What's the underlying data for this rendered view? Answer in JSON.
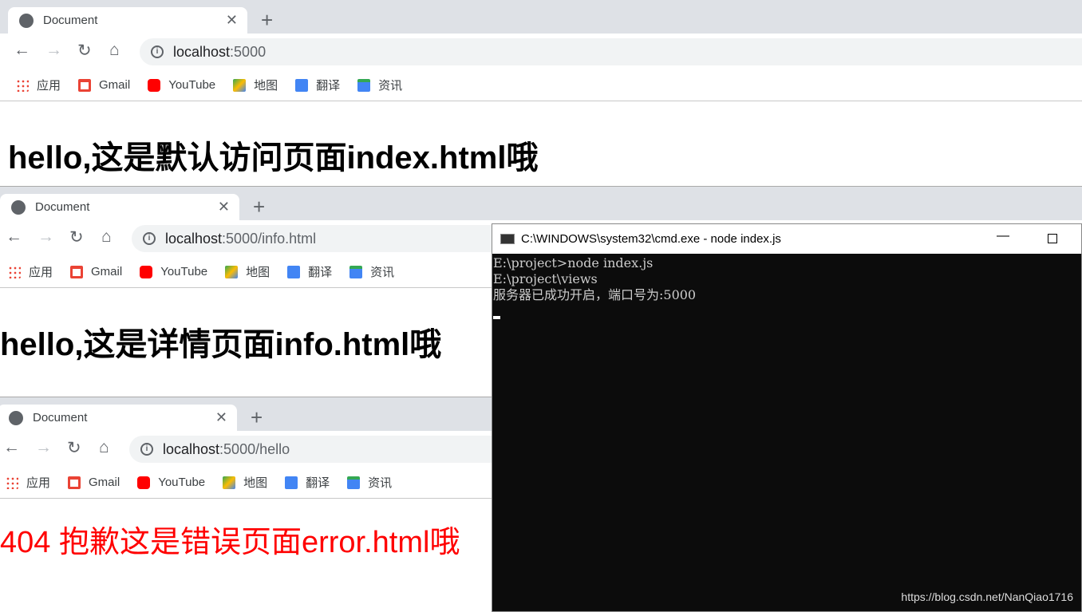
{
  "windows": [
    {
      "tab_title": "Document",
      "url_host": "localhost",
      "url_path": ":5000",
      "heading": "hello,这是默认访问页面index.html哦",
      "type": "h1"
    },
    {
      "tab_title": "Document",
      "url_host": "localhost",
      "url_path": ":5000/info.html",
      "heading": "hello,这是详情页面info.html哦",
      "type": "h1"
    },
    {
      "tab_title": "Document",
      "url_host": "localhost",
      "url_path": ":5000/hello",
      "heading": "404 抱歉这是错误页面error.html哦",
      "type": "error"
    }
  ],
  "bookmarks": [
    {
      "label": "应用",
      "icon": "apps-icon"
    },
    {
      "label": "Gmail",
      "icon": "gmail-icon"
    },
    {
      "label": "YouTube",
      "icon": "youtube-icon"
    },
    {
      "label": "地图",
      "icon": "maps-icon"
    },
    {
      "label": "翻译",
      "icon": "translate-icon"
    },
    {
      "label": "资讯",
      "icon": "news-icon"
    }
  ],
  "cmd": {
    "title": "C:\\WINDOWS\\system32\\cmd.exe - node  index.js",
    "lines": [
      "E:\\project>node index.js",
      "E:\\project\\views",
      "服务器已成功开启，端口号为:5000"
    ],
    "watermark": "https://blog.csdn.net/NanQiao1716"
  },
  "colors": {
    "error_text": "#ff0000",
    "tabstrip": "#dee1e6",
    "console_bg": "#0c0c0c"
  }
}
